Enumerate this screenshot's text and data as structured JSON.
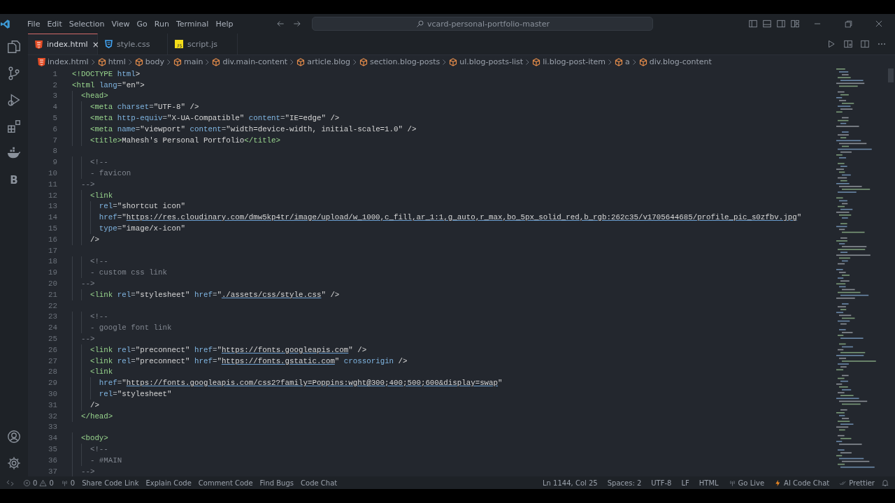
{
  "menu": [
    "File",
    "Edit",
    "Selection",
    "View",
    "Go",
    "Run",
    "Terminal",
    "Help"
  ],
  "command_center": {
    "text": "vcard-personal-portfolio-master"
  },
  "activity_bar": {
    "letter_item": "B"
  },
  "tabs": [
    {
      "label": "index.html",
      "kind": "html",
      "selected": true,
      "close": "×"
    },
    {
      "label": "style.css",
      "kind": "css",
      "selected": false
    },
    {
      "label": "script.js",
      "kind": "js",
      "selected": false
    }
  ],
  "breadcrumb": [
    {
      "label": "index.html",
      "kind": "file"
    },
    {
      "label": "html",
      "kind": "element"
    },
    {
      "label": "body",
      "kind": "element"
    },
    {
      "label": "main",
      "kind": "element"
    },
    {
      "label": "div.main-content",
      "kind": "element"
    },
    {
      "label": "article.blog",
      "kind": "element"
    },
    {
      "label": "section.blog-posts",
      "kind": "element"
    },
    {
      "label": "ul.blog-posts-list",
      "kind": "element"
    },
    {
      "label": "li.blog-post-item",
      "kind": "element"
    },
    {
      "label": "a",
      "kind": "element"
    },
    {
      "label": "div.blog-content",
      "kind": "element"
    }
  ],
  "editor": {
    "lines": [
      {
        "number": "1",
        "code": "<!DOCTYPE html>"
      },
      {
        "number": "2",
        "code": "<html lang=\"en\">"
      },
      {
        "number": "3",
        "code": "  <head>"
      },
      {
        "number": "4",
        "code": "    <meta charset=\"UTF-8\" />"
      },
      {
        "number": "5",
        "code": "    <meta http-equiv=\"X-UA-Compatible\" content=\"IE=edge\" />"
      },
      {
        "number": "6",
        "code": "    <meta name=\"viewport\" content=\"width=device-width, initial-scale=1.0\" />"
      },
      {
        "number": "7",
        "code": "    <title>Mahesh's Personal Portfolio</title>"
      },
      {
        "number": "8"
      },
      {
        "number": "9",
        "code": "    <!--"
      },
      {
        "number": "10",
        "code": "    - favicon"
      },
      {
        "number": "11",
        "code": "  -->"
      },
      {
        "number": "12",
        "code": "    <link"
      },
      {
        "number": "13",
        "code": "      rel=\"shortcut icon\""
      },
      {
        "number": "14",
        "code": "      href=\"https://res.cloudinary.com/dmw5kp4tr/image/upload/w_1000,c_fill,ar_1:1,g_auto,r_max,bo_5px_solid_red,b_rgb:262c35/v1705644685/profile_pic_s0zfbv.jpg\""
      },
      {
        "number": "15",
        "code": "      type=\"image/x-icon\""
      },
      {
        "number": "16",
        "code": "    />"
      },
      {
        "number": "17"
      },
      {
        "number": "18",
        "code": "    <!--"
      },
      {
        "number": "19",
        "code": "    - custom css link"
      },
      {
        "number": "20",
        "code": "  -->"
      },
      {
        "number": "21",
        "code": "    <link rel=\"stylesheet\" href=\"./assets/css/style.css\" />"
      },
      {
        "number": "22"
      },
      {
        "number": "23",
        "code": "    <!--"
      },
      {
        "number": "24",
        "code": "    - google font link"
      },
      {
        "number": "25",
        "code": "  -->"
      },
      {
        "number": "26",
        "code": "    <link rel=\"preconnect\" href=\"https://fonts.googleapis.com\" />"
      },
      {
        "number": "27",
        "code": "    <link rel=\"preconnect\" href=\"https://fonts.gstatic.com\" crossorigin />"
      },
      {
        "number": "28",
        "code": "    <link"
      },
      {
        "number": "29",
        "code": "      href=\"https://fonts.googleapis.com/css2?family=Poppins:wght@300;400;500;600&display=swap\""
      },
      {
        "number": "30",
        "code": "      rel=\"stylesheet\""
      },
      {
        "number": "31",
        "code": "    />"
      },
      {
        "number": "32",
        "code": "  </head>"
      },
      {
        "number": "33"
      },
      {
        "number": "34",
        "code": "  <body>"
      },
      {
        "number": "35",
        "code": "    <!--"
      },
      {
        "number": "36",
        "code": "    - #MAIN"
      },
      {
        "number": "37",
        "code": "  -->"
      }
    ]
  },
  "status_bar": {
    "errors": "0",
    "warnings": "0",
    "ports": "0",
    "left": [
      "Share Code Link",
      "Explain Code",
      "Comment Code",
      "Find Bugs",
      "Code Chat"
    ],
    "right": [
      {
        "label": "Ln 1144, Col 25",
        "kind": "plain"
      },
      {
        "label": "Spaces: 2",
        "kind": "plain"
      },
      {
        "label": "UTF-8",
        "kind": "plain"
      },
      {
        "label": "LF",
        "kind": "plain"
      },
      {
        "label": "HTML",
        "kind": "plain"
      },
      {
        "label": "Go Live",
        "kind": "golive"
      },
      {
        "label": "AI Code Chat",
        "kind": "ai"
      },
      {
        "label": "Prettier",
        "kind": "prettier"
      }
    ]
  }
}
